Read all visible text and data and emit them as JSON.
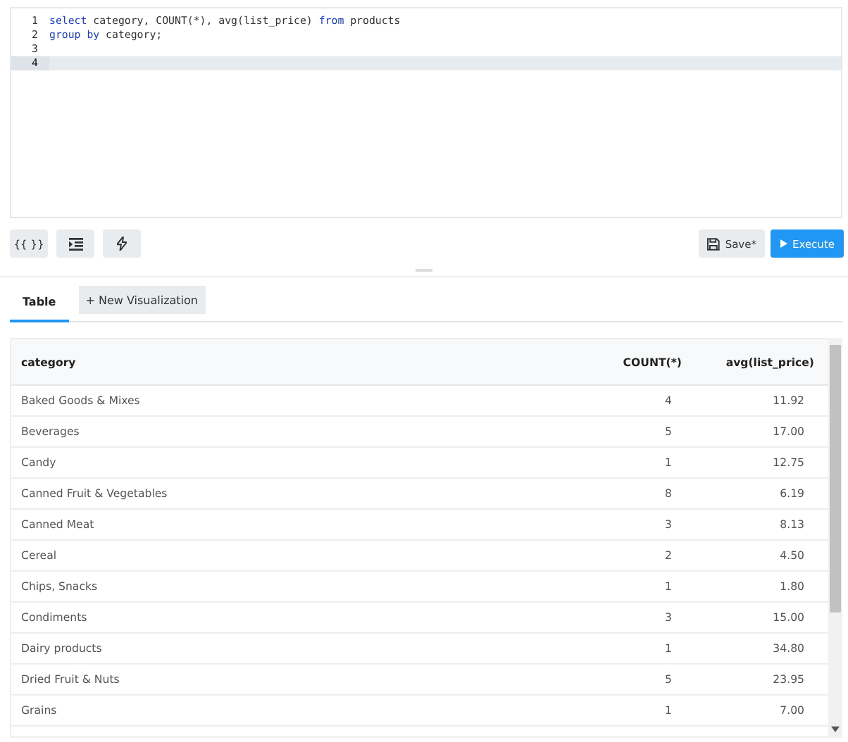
{
  "editor": {
    "lines": [
      {
        "number": "1",
        "active": false,
        "tokens": [
          {
            "kind": "keyword",
            "text": "select"
          },
          {
            "kind": "plain",
            "text": " category, COUNT(*), avg(list_price) "
          },
          {
            "kind": "keyword",
            "text": "from"
          },
          {
            "kind": "plain",
            "text": " products"
          }
        ]
      },
      {
        "number": "2",
        "active": false,
        "tokens": [
          {
            "kind": "keyword",
            "text": "group by"
          },
          {
            "kind": "plain",
            "text": " category;"
          }
        ]
      },
      {
        "number": "3",
        "active": false
      },
      {
        "number": "4",
        "active": true
      }
    ]
  },
  "toolbar": {
    "left": [
      {
        "kind": "braces",
        "label": "{{ }}"
      },
      {
        "kind": "indent"
      },
      {
        "kind": "bolt"
      }
    ],
    "save": {
      "label": "Save*"
    },
    "execute": {
      "label": "Execute"
    }
  },
  "tabs": [
    {
      "label": "Table",
      "selected": true,
      "kind": "tab"
    },
    {
      "label": "+ New Visualization",
      "selected": false,
      "kind": "button"
    }
  ],
  "table": {
    "columns": [
      {
        "label": "category"
      },
      {
        "label": "COUNT(*)"
      },
      {
        "label": "avg(list_price)"
      }
    ],
    "rows": [
      [
        "Baked Goods & Mixes",
        "4",
        "11.92"
      ],
      [
        "Beverages",
        "5",
        "17.00"
      ],
      [
        "Candy",
        "1",
        "12.75"
      ],
      [
        "Canned Fruit & Vegetables",
        "8",
        "6.19"
      ],
      [
        "Canned Meat",
        "3",
        "8.13"
      ],
      [
        "Cereal",
        "2",
        "4.50"
      ],
      [
        "Chips, Snacks",
        "1",
        "1.80"
      ],
      [
        "Condiments",
        "3",
        "15.00"
      ],
      [
        "Dairy products",
        "1",
        "34.80"
      ],
      [
        "Dried Fruit & Nuts",
        "5",
        "23.95"
      ],
      [
        "Grains",
        "1",
        "7.00"
      ]
    ]
  }
}
